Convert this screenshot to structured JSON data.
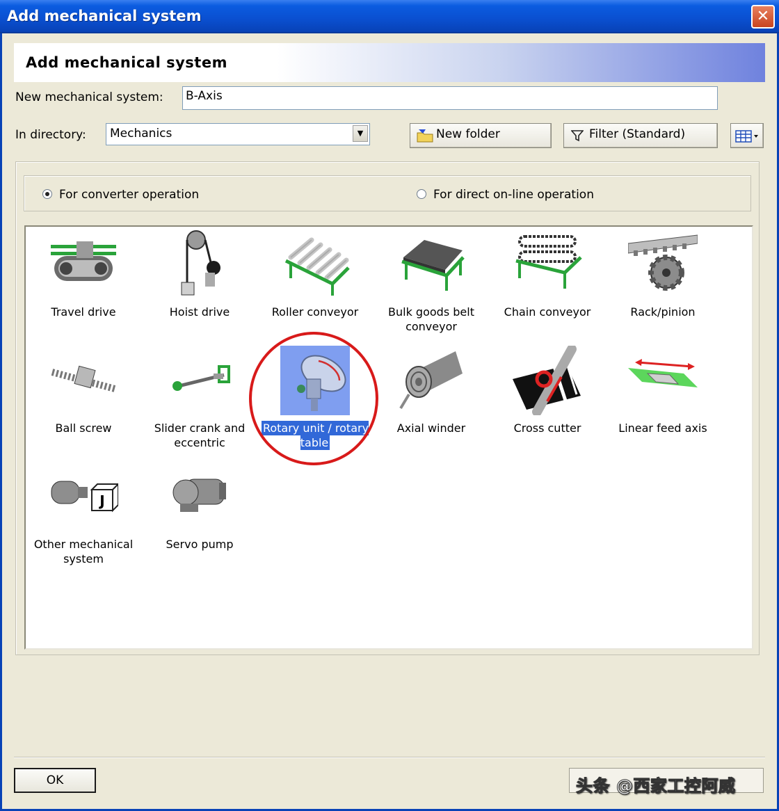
{
  "window": {
    "title": "Add mechanical system",
    "close_glyph": "✕"
  },
  "header": {
    "title": "Add mechanical system"
  },
  "form": {
    "name_label": "New mechanical system:",
    "name_value": "B-Axis",
    "dir_label": "In directory:",
    "dir_value": "Mechanics",
    "new_folder_label": "New folder",
    "filter_label": "Filter (Standard)"
  },
  "operation": {
    "converter_label": "For converter operation",
    "converter_selected": true,
    "online_label": "For direct on-line operation",
    "online_selected": false
  },
  "items": [
    {
      "label": "Travel drive",
      "icon": "travel-drive-icon"
    },
    {
      "label": "Hoist drive",
      "icon": "hoist-drive-icon"
    },
    {
      "label": "Roller conveyor",
      "icon": "roller-conveyor-icon"
    },
    {
      "label": "Bulk goods belt conveyor",
      "icon": "belt-conveyor-icon"
    },
    {
      "label": "Chain conveyor",
      "icon": "chain-conveyor-icon"
    },
    {
      "label": "Rack/pinion",
      "icon": "rack-pinion-icon"
    },
    {
      "label": "Ball screw",
      "icon": "ball-screw-icon"
    },
    {
      "label": "Slider crank and eccentric",
      "icon": "slider-crank-icon"
    },
    {
      "label": "Rotary unit / rotary table",
      "icon": "rotary-table-icon",
      "selected": true
    },
    {
      "label": "Axial winder",
      "icon": "axial-winder-icon"
    },
    {
      "label": "Cross cutter",
      "icon": "cross-cutter-icon"
    },
    {
      "label": "Linear feed axis",
      "icon": "linear-feed-icon"
    },
    {
      "label": "Other mechanical system",
      "icon": "other-mechanical-icon"
    },
    {
      "label": "Servo pump",
      "icon": "servo-pump-icon"
    }
  ],
  "footer": {
    "ok_label": "OK"
  },
  "watermark": "头条 @西家工控阿威"
}
